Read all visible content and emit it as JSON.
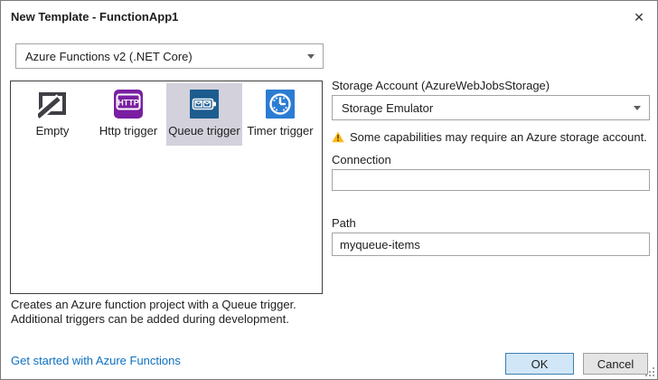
{
  "window": {
    "title": "New Template - FunctionApp1",
    "close_icon": "✕"
  },
  "version_selector": {
    "value": "Azure Functions v2 (.NET Core)"
  },
  "templates": {
    "items": [
      {
        "label": "Empty",
        "icon": "empty-project-icon",
        "selected": false
      },
      {
        "label": "Http trigger",
        "icon": "http-trigger-icon",
        "selected": false
      },
      {
        "label": "Queue trigger",
        "icon": "queue-trigger-icon",
        "selected": true
      },
      {
        "label": "Timer trigger",
        "icon": "timer-trigger-icon",
        "selected": false
      }
    ]
  },
  "settings": {
    "storage_account": {
      "label": "Storage Account (AzureWebJobsStorage)",
      "value": "Storage Emulator"
    },
    "warning_text": "Some capabilities may require an Azure storage account.",
    "connection": {
      "label": "Connection",
      "value": ""
    },
    "path": {
      "label": "Path",
      "value": "myqueue-items"
    }
  },
  "description": {
    "line1": "Creates an Azure function project with a Queue trigger.",
    "line2": "Additional triggers can be added during development."
  },
  "footer": {
    "link": "Get started with Azure Functions",
    "ok_label": "OK",
    "cancel_label": "Cancel"
  },
  "colors": {
    "link": "#0e70c0",
    "selection_bg": "#d3d1dc",
    "warning_icon": "#fcb814",
    "ok_bg": "#d1e6f7",
    "ok_border": "#3c7fb1",
    "empty_icon_gray": "#3f3f46",
    "http_icon_purple": "#7a1fa2",
    "queue_icon_blue": "#1d5c8f",
    "timer_icon_blue": "#2b7cd3"
  }
}
